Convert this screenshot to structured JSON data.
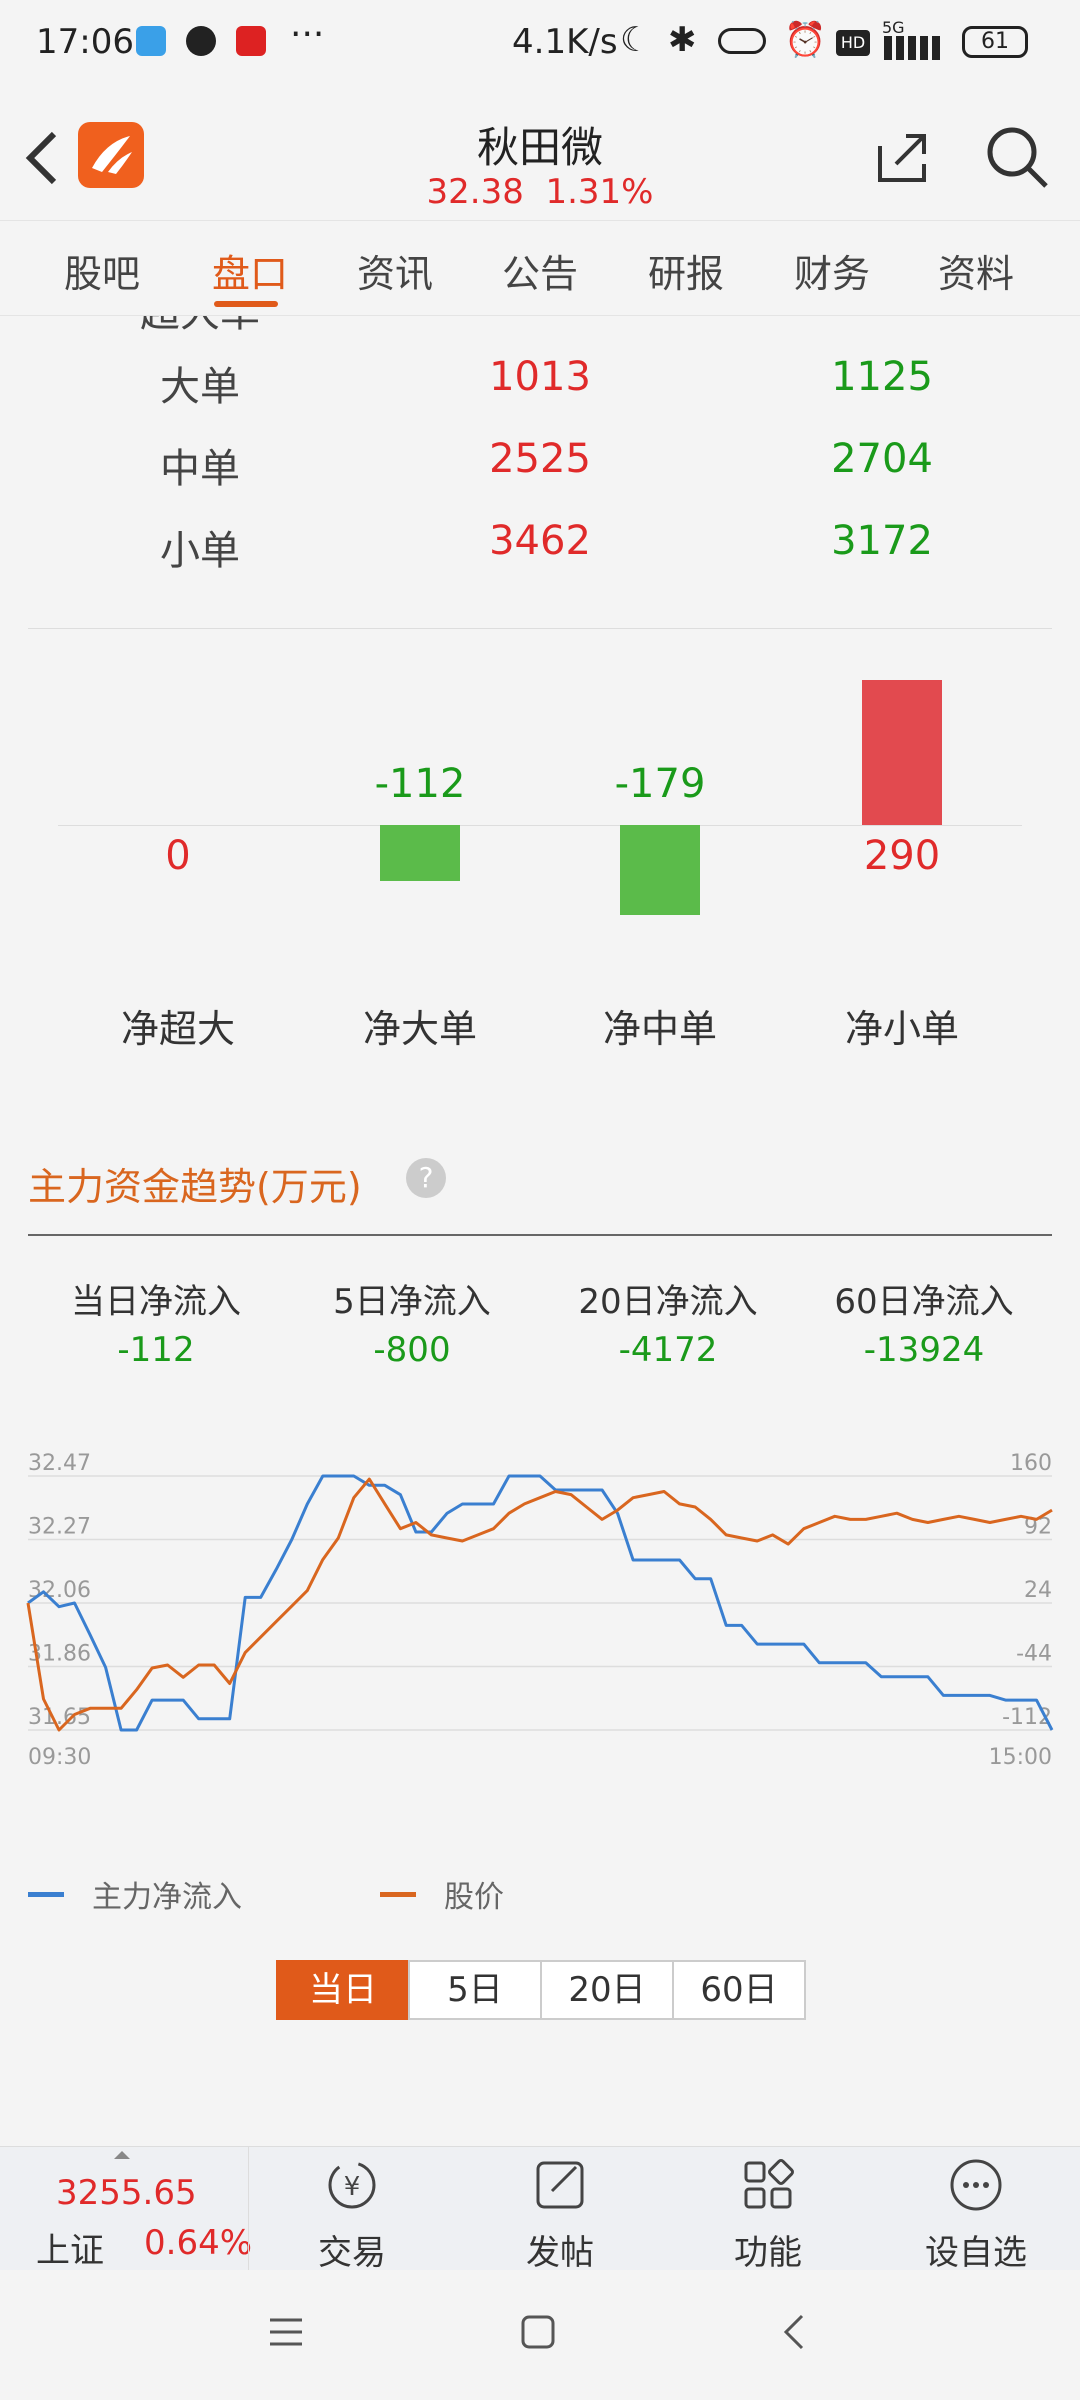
{
  "status": {
    "time": "17:06",
    "net_speed": "4.1K/s",
    "signal": "5G",
    "battery": "61"
  },
  "header": {
    "title": "秋田微",
    "price": "32.38",
    "change_pct": "1.31%"
  },
  "tabs": [
    {
      "label": "股吧"
    },
    {
      "label": "盘口"
    },
    {
      "label": "资讯"
    },
    {
      "label": "公告"
    },
    {
      "label": "研报"
    },
    {
      "label": "财务"
    },
    {
      "label": "资料"
    }
  ],
  "order_table": {
    "rows": [
      {
        "label": "大单",
        "buy": "1013",
        "sell": "1125"
      },
      {
        "label": "中单",
        "buy": "2525",
        "sell": "2704"
      },
      {
        "label": "小单",
        "buy": "3462",
        "sell": "3172"
      }
    ]
  },
  "net_bars": {
    "items": [
      {
        "label": "净超大",
        "value": 0,
        "text": "0"
      },
      {
        "label": "净大单",
        "value": -112,
        "text": "-112"
      },
      {
        "label": "净中单",
        "value": -179,
        "text": "-179"
      },
      {
        "label": "净小单",
        "value": 290,
        "text": "290"
      }
    ],
    "colors": {
      "positive": "#e24a4f",
      "negative": "#5bbb4a"
    }
  },
  "trend": {
    "title": "主力资金趋势(万元)",
    "stats": [
      {
        "label": "当日净流入",
        "value": "-112"
      },
      {
        "label": "5日净流入",
        "value": "-800"
      },
      {
        "label": "20日净流入",
        "value": "-4172"
      },
      {
        "label": "60日净流入",
        "value": "-13924"
      }
    ]
  },
  "chart_data": {
    "type": "line",
    "x_start": "09:30",
    "x_end": "15:00",
    "left_axis_ticks": [
      "32.47",
      "32.27",
      "32.06",
      "31.86",
      "31.65"
    ],
    "right_axis_ticks": [
      "160",
      "92",
      "24",
      "-44",
      "-112"
    ],
    "left_ylim": [
      31.65,
      32.47
    ],
    "right_ylim": [
      -112,
      160
    ],
    "series": [
      {
        "name": "主力净流入",
        "color": "#3a7fd0",
        "axis": "right",
        "values": [
          24,
          36,
          20,
          24,
          -10,
          -45,
          -112,
          -112,
          -80,
          -80,
          -80,
          -100,
          -100,
          -100,
          30,
          30,
          60,
          92,
          130,
          160,
          160,
          160,
          150,
          150,
          140,
          100,
          100,
          120,
          130,
          130,
          130,
          160,
          160,
          160,
          145,
          145,
          145,
          145,
          120,
          70,
          70,
          70,
          70,
          50,
          50,
          0,
          0,
          -20,
          -20,
          -20,
          -20,
          -40,
          -40,
          -40,
          -40,
          -55,
          -55,
          -55,
          -55,
          -75,
          -75,
          -75,
          -75,
          -80,
          -80,
          -80,
          -112
        ]
      },
      {
        "name": "股价",
        "color": "#d9661f",
        "axis": "left",
        "values": [
          32.06,
          31.75,
          31.65,
          31.7,
          31.72,
          31.72,
          31.72,
          31.78,
          31.85,
          31.86,
          31.82,
          31.86,
          31.86,
          31.8,
          31.9,
          31.95,
          32.0,
          32.05,
          32.1,
          32.2,
          32.27,
          32.4,
          32.46,
          32.38,
          32.3,
          32.32,
          32.28,
          32.27,
          32.26,
          32.28,
          32.3,
          32.35,
          32.38,
          32.4,
          32.42,
          32.41,
          32.37,
          32.33,
          32.36,
          32.4,
          32.41,
          32.42,
          32.38,
          32.37,
          32.33,
          32.28,
          32.27,
          32.26,
          32.28,
          32.25,
          32.3,
          32.32,
          32.34,
          32.33,
          32.33,
          32.34,
          32.35,
          32.33,
          32.32,
          32.33,
          32.34,
          32.33,
          32.32,
          32.33,
          32.34,
          32.33,
          32.36
        ]
      }
    ]
  },
  "periods": [
    {
      "label": "当日",
      "active": true
    },
    {
      "label": "5日"
    },
    {
      "label": "20日"
    },
    {
      "label": "60日"
    }
  ],
  "bottom_bar": {
    "index_value": "3255.65",
    "index_name": "上证",
    "index_change": "0.64%",
    "items": [
      {
        "label": "交易"
      },
      {
        "label": "发帖"
      },
      {
        "label": "功能"
      },
      {
        "label": "设自选"
      }
    ]
  }
}
